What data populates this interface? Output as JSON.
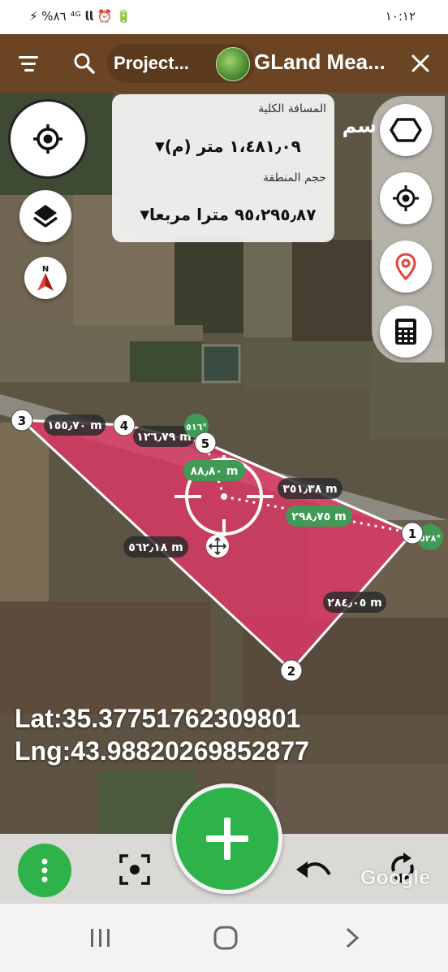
{
  "status_bar": {
    "left": "⚡ %٨٦ ⁴ᴳ 𝗹𝗹 ⏰ 🔋",
    "time": "١٠:١٢"
  },
  "toolbar": {
    "menu_icon": "hamburger-icon",
    "search_icon": "search-icon",
    "project_label": "Project...",
    "app_title": "GLand Mea...",
    "close_icon": "close-icon",
    "background_color": "#6b4423"
  },
  "measure_panel": {
    "total_distance_label": "المسافة الكلية",
    "total_distance_value": "١،٤٨١٫٠٩ متر (م)",
    "area_label": "حجم المنطقة",
    "area_value": "٩٥،٢٩٥٫٨٧ مترا مربعا"
  },
  "map_overlay_text": "سم",
  "left_controls": [
    "my-location-icon",
    "layers-icon",
    "compass-icon"
  ],
  "right_controls": [
    "polygon-icon",
    "target-icon",
    "map-pin-icon",
    "calculator-icon"
  ],
  "points": [
    {
      "label": "1",
      "angle": "٥٢٨°"
    },
    {
      "label": "2"
    },
    {
      "label": "3"
    },
    {
      "label": "4"
    },
    {
      "label": "5",
      "angle": "٥١٦°"
    }
  ],
  "segments": [
    {
      "label": "٣٥١٫٣٨ m",
      "style": "dark"
    },
    {
      "label": "٢٨٤٫٠٥ m",
      "style": "dark"
    },
    {
      "label": "٥٦٢٫١٨ m",
      "style": "dark"
    },
    {
      "label": "١٥٥٫٧٠ m",
      "style": "dark"
    },
    {
      "label": "١٢٦٫٧٩ m",
      "style": "dark"
    },
    {
      "label": "٨٨٫٨٠ m",
      "style": "green"
    },
    {
      "label": "٢٩٨٫٧٥ m",
      "style": "green"
    }
  ],
  "cursor": {
    "lat": "Lat:35.37751762309801",
    "lng": "Lng:43.98820269852877"
  },
  "bottom_bar": {
    "items": [
      "more-vert-icon",
      "focus-icon",
      "add-icon",
      "undo-icon",
      "refresh-icon"
    ],
    "watermark": "Google"
  },
  "nav_bar": [
    "recents-icon",
    "home-icon",
    "back-icon"
  ],
  "colors": {
    "polygon_fill": "#e23768",
    "accent_green": "#2db34a",
    "toolbar_brown": "#6b4423"
  }
}
